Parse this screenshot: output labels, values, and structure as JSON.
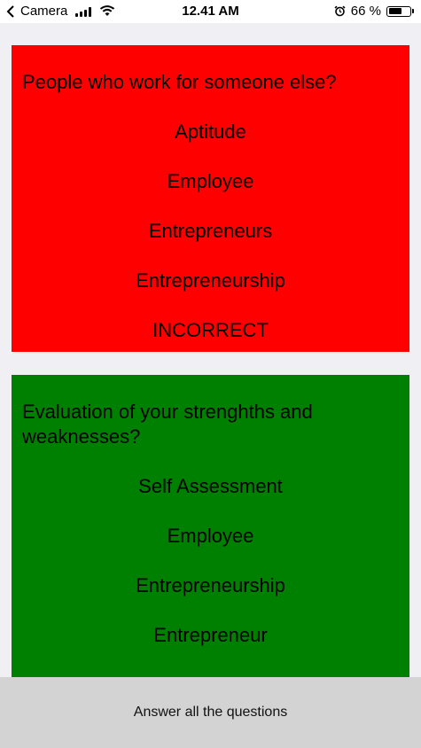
{
  "status_bar": {
    "back_app": "Camera",
    "time": "12.41 AM",
    "battery": "66 %",
    "battery_level": 0.66,
    "icons": [
      "chevron-left-icon",
      "signal-icon",
      "wifi-icon",
      "alarm-icon",
      "battery-icon"
    ]
  },
  "colors": {
    "incorrect": "#ff0000",
    "correct": "#008000",
    "background": "#efeff4",
    "bottom_bar": "#d3d3d3"
  },
  "questions": [
    {
      "question": "People who work for someone else?",
      "options": [
        "Aptitude",
        "Employee",
        "Entrepreneurs",
        "Entrepreneurship"
      ],
      "result": "INCORRECT"
    },
    {
      "question": "Evaluation of your strenghths and weaknesses?",
      "options": [
        "Self Assessment",
        "Employee",
        "Entrepreneurship",
        "Entrepreneur"
      ]
    }
  ],
  "footer": {
    "message": "Answer all the questions"
  }
}
